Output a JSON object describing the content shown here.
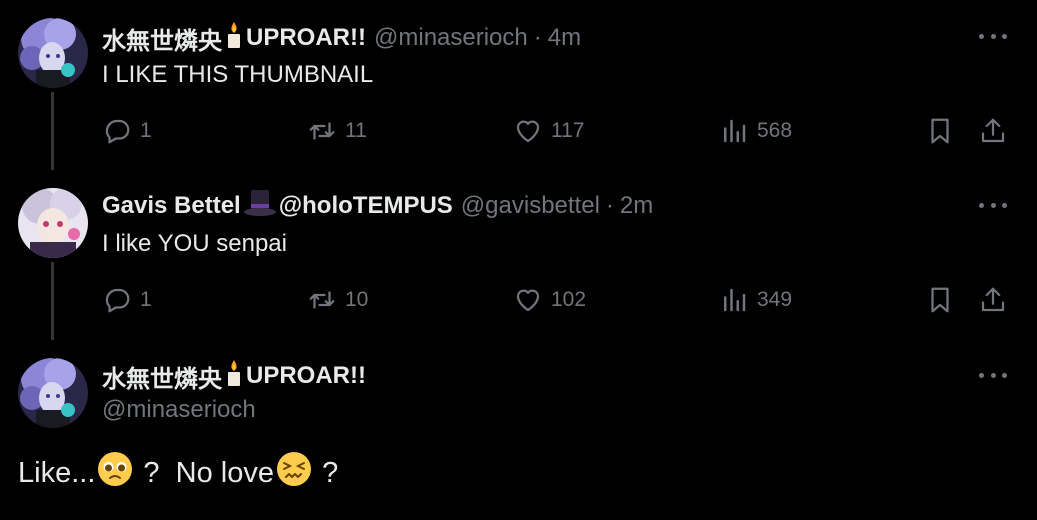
{
  "tweets": [
    {
      "name": "水無世燐央",
      "name_suffix": "UPROAR!!",
      "handle": "@minaserioch",
      "time": "4m",
      "text": "I LIKE THIS THUMBNAIL",
      "replies": "1",
      "retweets": "11",
      "likes": "117",
      "views": "568"
    },
    {
      "name": "Gavis Bettel",
      "name_suffix": "@holoTEMPUS",
      "handle": "@gavisbettel",
      "time": "2m",
      "text": "I like YOU senpai",
      "replies": "1",
      "retweets": "10",
      "likes": "102",
      "views": "349"
    },
    {
      "name": "水無世燐央",
      "name_suffix": "UPROAR!!",
      "handle": "@minaserioch",
      "text_part1": "Like...",
      "text_part2": " ?  No love",
      "text_part3": " ?"
    }
  ],
  "separator": "·",
  "icons": {
    "reply": "reply-icon",
    "retweet": "retweet-icon",
    "like": "heart-icon",
    "views": "views-icon",
    "bookmark": "bookmark-icon",
    "share": "share-icon",
    "more": "more-icon"
  },
  "colors": {
    "background": "#000000",
    "text": "#e7e9ea",
    "muted": "#71767b",
    "thread": "#333639"
  }
}
